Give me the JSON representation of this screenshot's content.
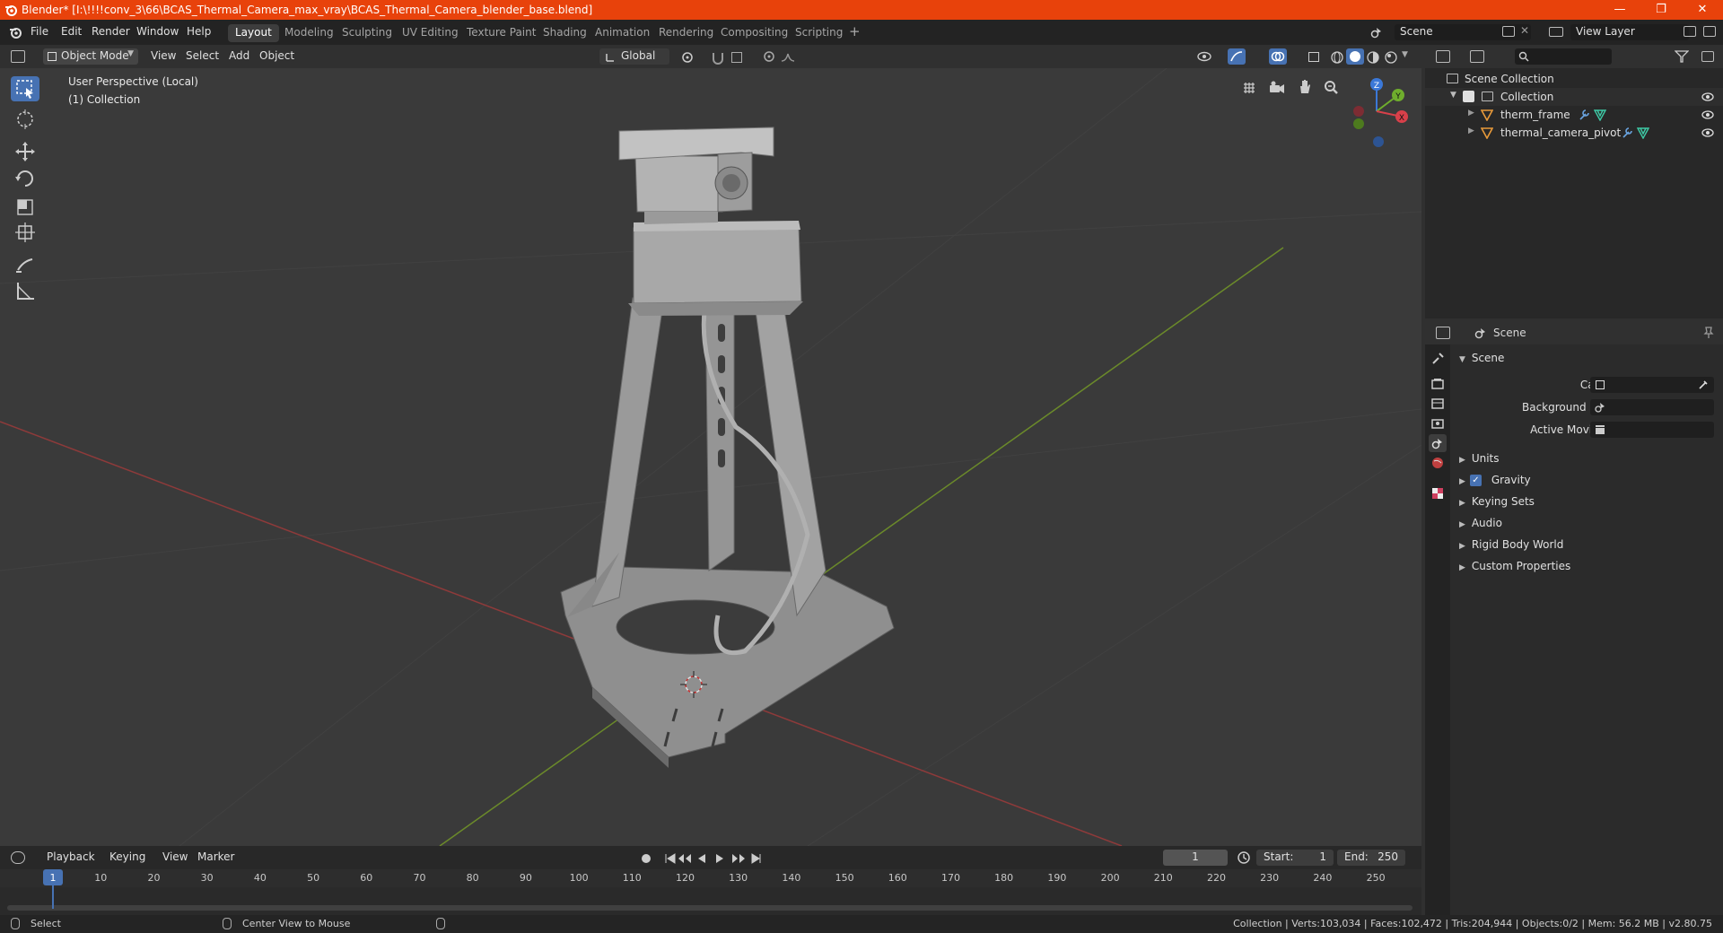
{
  "window": {
    "title": "Blender* [I:\\!!!!conv_3\\66\\BCAS_Thermal_Camera_max_vray\\BCAS_Thermal_Camera_blender_base.blend]",
    "minimize": "—",
    "maximize": "❐",
    "close": "✕",
    "accent": "#e8420b"
  },
  "menu": [
    "File",
    "Edit",
    "Render",
    "Window",
    "Help"
  ],
  "workspaces": [
    "Layout",
    "Modeling",
    "Sculpting",
    "UV Editing",
    "Texture Paint",
    "Shading",
    "Animation",
    "Rendering",
    "Compositing",
    "Scripting"
  ],
  "active_workspace": "Layout",
  "scene_field": "Scene",
  "view_layer_field": "View Layer",
  "viewport_header": {
    "mode": "Object Mode",
    "menus": [
      "View",
      "Select",
      "Add",
      "Object"
    ],
    "orientation": "Global"
  },
  "viewport": {
    "perspective": "User Perspective (Local)",
    "collection": "(1) Collection",
    "gizmo": {
      "x": "X",
      "y": "Y",
      "z": "Z"
    }
  },
  "outliner": {
    "root": "Scene Collection",
    "collection": "Collection",
    "objects": [
      "therm_frame",
      "thermal_camera_pivot"
    ]
  },
  "properties": {
    "header": "Scene",
    "section": "Scene",
    "camera_label": "Camera",
    "background_label": "Background Scene",
    "clip_label": "Active Movie Clip",
    "subsections": [
      "Units",
      "Gravity",
      "Keying Sets",
      "Audio",
      "Rigid Body World",
      "Custom Properties"
    ],
    "gravity_checked": true
  },
  "timeline": {
    "menus": [
      "Playback",
      "Keying",
      "View",
      "Marker"
    ],
    "current_frame": "1",
    "start_label": "Start:",
    "start": "1",
    "end_label": "End:",
    "end": "250",
    "ticks": [
      "1",
      "10",
      "20",
      "30",
      "40",
      "50",
      "60",
      "70",
      "80",
      "90",
      "100",
      "110",
      "120",
      "130",
      "140",
      "150",
      "160",
      "170",
      "180",
      "190",
      "200",
      "210",
      "220",
      "230",
      "240",
      "250"
    ]
  },
  "status": {
    "select": "Select",
    "center": "Center View to Mouse",
    "stats": "Collection | Verts:103,034 | Faces:102,472 | Tris:204,944 | Objects:0/2 | Mem: 56.2 MB | v2.80.75"
  },
  "colors": {
    "axis_x": "#9a3b3b",
    "axis_y": "#6b8a2a",
    "active_tool": "#4772b3"
  }
}
